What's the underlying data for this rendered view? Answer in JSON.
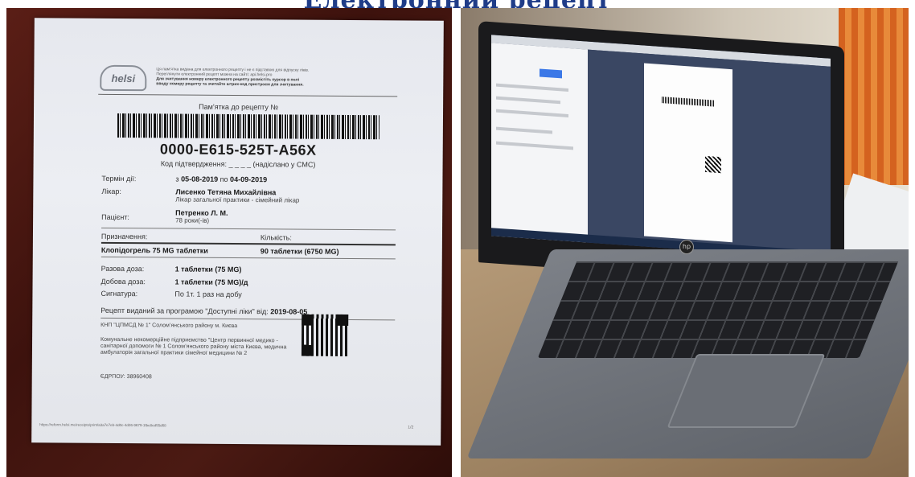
{
  "slide": {
    "title": "Електронний рецепт"
  },
  "recipe": {
    "logo_text": "helsi",
    "header_note_1": "Ця пам’ятка видана для електронного рецепту і не є підставою для відпуску ліків.",
    "header_note_2": "Переглянути електронний рецепт можна на сайті: api.helsi.pro",
    "header_note_3": "Для зчитування номеру електронного рецепту розмістіть курсор в полі",
    "header_note_4": "вводу номеру рецепту та зчитайте штрих-код пристроєм для зчитування.",
    "memo_heading": "Пам’ятка до рецепту №",
    "number": "0000-E615-525T-A56X",
    "confirm_code": "Код підтвердження: _ _ _ _ (надіслано у СМС)",
    "term_label": "Термін дії:",
    "term_prefix": "з",
    "term_from": "05-08-2019",
    "term_mid": "по",
    "term_to": "04-09-2019",
    "doctor_label": "Лікар:",
    "doctor_name": "Лисенко Тетяна Михайлівна",
    "doctor_role": "Лікар загальної практики - сімейний лікар",
    "patient_label": "Пацієнт:",
    "patient_name": "Петренко Л. М.",
    "patient_age": "78 роки(-ів)",
    "prescription_label": "Призначення:",
    "quantity_label": "Кількість:",
    "drug": "Клопідогрель 75 MG таблетки",
    "drug_qty": "90 таблетки (6750 MG)",
    "single_dose_label": "Разова доза:",
    "single_dose": "1 таблетки (75 MG)",
    "daily_dose_label": "Добова доза:",
    "daily_dose": "1 таблетки (75 MG)/д",
    "signature_label": "Сигнатура:",
    "signature": "По 1т. 1 раз на добу",
    "program_text": "Рецепт виданий за програмою \"Доступні ліки\" від:",
    "program_date": "2019-08-05",
    "clinic_short": "КНП \"ЦПМСД № 1\" Солом’янського району м. Києва",
    "clinic_full": "Комунальне некомерційне підприємство \"Центр первинної медико - санітарної допомоги № 1 Солом’янського району міста Києва, медична амбулаторія загальної практики сімейної медицини № 2",
    "edrpou": "ЄДРПОУ: 38960408",
    "footer_url": "https://reform.helsi.me/receipts/print/a3a7e7eb-4d0c-4d26-9679-1fbe8ed55d68",
    "page_num": "1/2"
  },
  "laptop": {
    "brand": "hp"
  }
}
